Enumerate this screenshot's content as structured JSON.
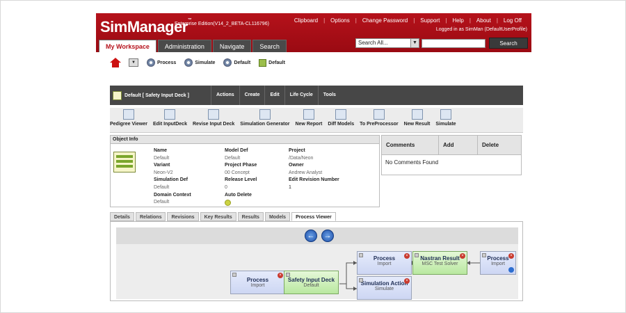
{
  "brand": {
    "name": "SimManager",
    "tm": "™",
    "edition": "Enterprise Edition(V14_2_BETA-CL116796)"
  },
  "toplinks": [
    "Clipboard",
    "Options",
    "Change Password",
    "Support",
    "Help",
    "About",
    "Log Off"
  ],
  "logged_in": "Logged in as SimMan (DefaultUserProfile)",
  "main_tabs": [
    "My Workspace",
    "Administration",
    "Navigate",
    "Search"
  ],
  "search": {
    "scope": "Search All...",
    "button": "Search",
    "value": ""
  },
  "quickbar": [
    "Process",
    "Simulate",
    "Default",
    "Default"
  ],
  "object_title": "Default [ Safety Input Deck ]",
  "menus": [
    "Actions",
    "Create",
    "Edit",
    "Life Cycle",
    "Tools"
  ],
  "tools": [
    "Pedigree Viewer",
    "Edit InputDeck",
    "Revise Input Deck",
    "Simulation Generator",
    "New Report",
    "Diff Models",
    "To PreProcessor",
    "New Result",
    "Simulate"
  ],
  "object_info": {
    "header": "Object Info",
    "col1": [
      {
        "label": "Name",
        "value": "Default"
      },
      {
        "label": "Variant",
        "value": "Neon-V2"
      },
      {
        "label": "Simulation Def",
        "value": "Default"
      },
      {
        "label": "Domain Context",
        "value": "Default"
      }
    ],
    "col2": [
      {
        "label": "Model Def",
        "value": "Default"
      },
      {
        "label": "Project Phase",
        "value": "00 Concept"
      },
      {
        "label": "Release Level",
        "value": "0"
      },
      {
        "label": "Auto Delete",
        "value": ""
      }
    ],
    "col3": [
      {
        "label": "Project",
        "value": "/Data/Neon"
      },
      {
        "label": "Owner",
        "value": "Andrew Analyst"
      },
      {
        "label": "Edit Revision Number",
        "value": "1"
      }
    ]
  },
  "comments": {
    "headers": [
      "Comments",
      "Add",
      "Delete"
    ],
    "empty": "No Comments Found"
  },
  "bottom_tabs": [
    "Details",
    "Relations",
    "Revisions",
    "Key Results",
    "Results",
    "Models",
    "Process Viewer"
  ],
  "nav": {
    "back": "←",
    "forward": "→"
  },
  "nodes": [
    {
      "title": "Process",
      "sub": "Import"
    },
    {
      "title": "Safety Input Deck",
      "sub": "Default"
    },
    {
      "title": "Process",
      "sub": "Import"
    },
    {
      "title": "Simulation Action",
      "sub": "Simulate"
    },
    {
      "title": "Nastran Result",
      "sub": "MSC Test Solver"
    },
    {
      "title": "Process",
      "sub": "Import"
    }
  ],
  "colors": {
    "brand_red": "#b5121b",
    "dark_bar": "#474747",
    "node_blue": "#cdd6f3",
    "node_green": "#b9e8a0"
  },
  "icons": [
    "home-icon",
    "dropdown-icon",
    "gear-icon",
    "deck-icon",
    "close-icon",
    "arrow-left-icon",
    "arrow-right-icon",
    "plus-icon"
  ]
}
